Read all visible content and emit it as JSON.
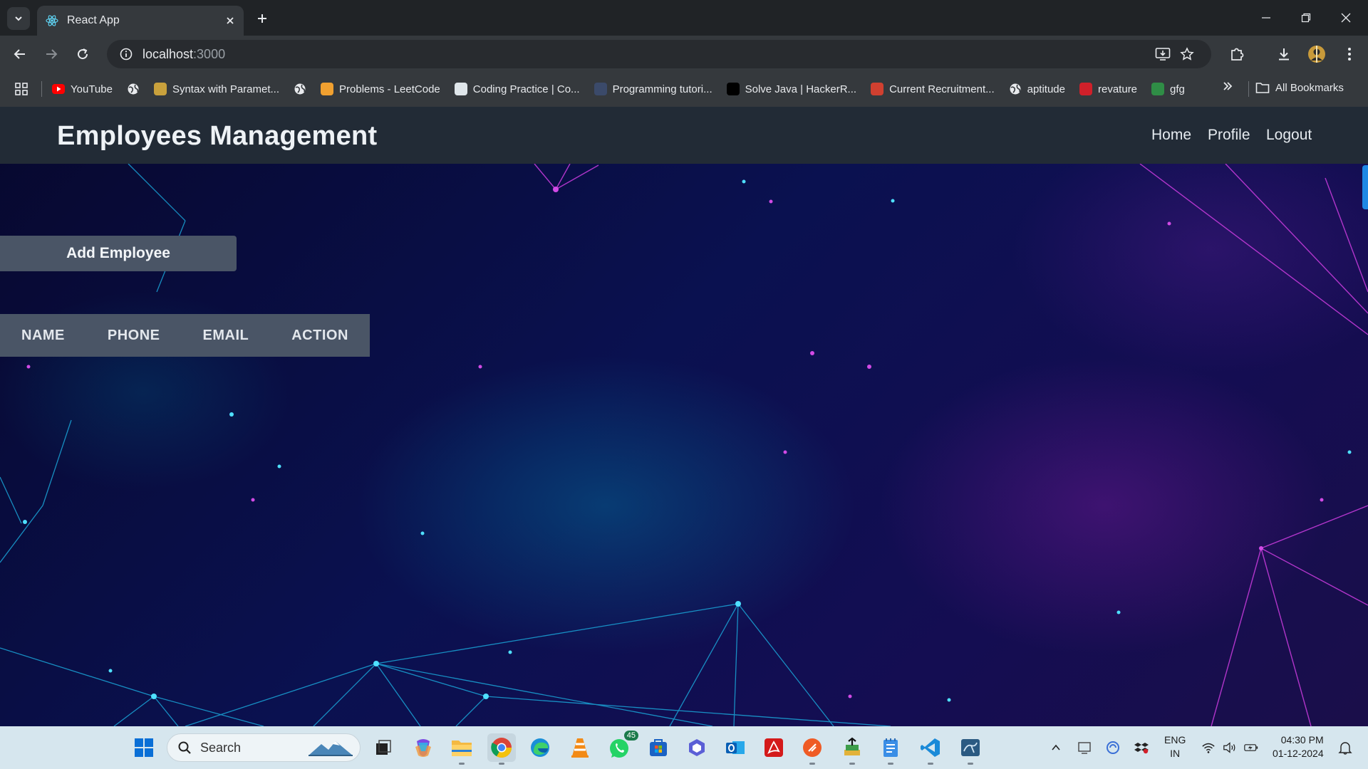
{
  "browser": {
    "tab_title": "React App",
    "url_host": "localhost",
    "url_port": ":3000",
    "bookmarks": [
      {
        "label": "YouTube",
        "icon": "youtube-icon",
        "color": "#ff0000"
      },
      {
        "label": "",
        "icon": "globe-icon",
        "color": "#e8eaed"
      },
      {
        "label": "Syntax with Paramet...",
        "icon": "syntax-icon",
        "color": "#c9a13c"
      },
      {
        "label": "",
        "icon": "globe-icon",
        "color": "#e8eaed"
      },
      {
        "label": "Problems - LeetCode",
        "icon": "leetcode-icon",
        "color": "#f0a030"
      },
      {
        "label": "Coding Practice | Co...",
        "icon": "codingninjas-icon",
        "color": "#dfe6ea"
      },
      {
        "label": "Programming tutori...",
        "icon": "programiz-icon",
        "color": "#3b4a6a"
      },
      {
        "label": "Solve Java | HackerR...",
        "icon": "hackerrank-icon",
        "color": "#000000"
      },
      {
        "label": "Current Recruitment...",
        "icon": "recruitment-icon",
        "color": "#d04030"
      },
      {
        "label": "aptitude",
        "icon": "globe-icon",
        "color": "#e8eaed"
      },
      {
        "label": "revature",
        "icon": "tuf-icon",
        "color": "#d0202a"
      },
      {
        "label": "gfg",
        "icon": "gfg-icon",
        "color": "#2f8d46"
      }
    ],
    "all_bookmarks": "All Bookmarks"
  },
  "app": {
    "brand": "Employees Management",
    "nav": {
      "home": "Home",
      "profile": "Profile",
      "logout": "Logout"
    },
    "add_button": "Add Employee",
    "table_headers": [
      "NAME",
      "PHONE",
      "EMAIL",
      "ACTION"
    ]
  },
  "taskbar": {
    "search_placeholder": "Search",
    "whatsapp_badge": "45",
    "lang_primary": "ENG",
    "lang_secondary": "IN",
    "time": "04:30 PM",
    "date": "01-12-2024"
  },
  "colors": {
    "navbar": "#222b36",
    "button": "#4a5566",
    "scroll_indicator": "#1e88e5"
  }
}
